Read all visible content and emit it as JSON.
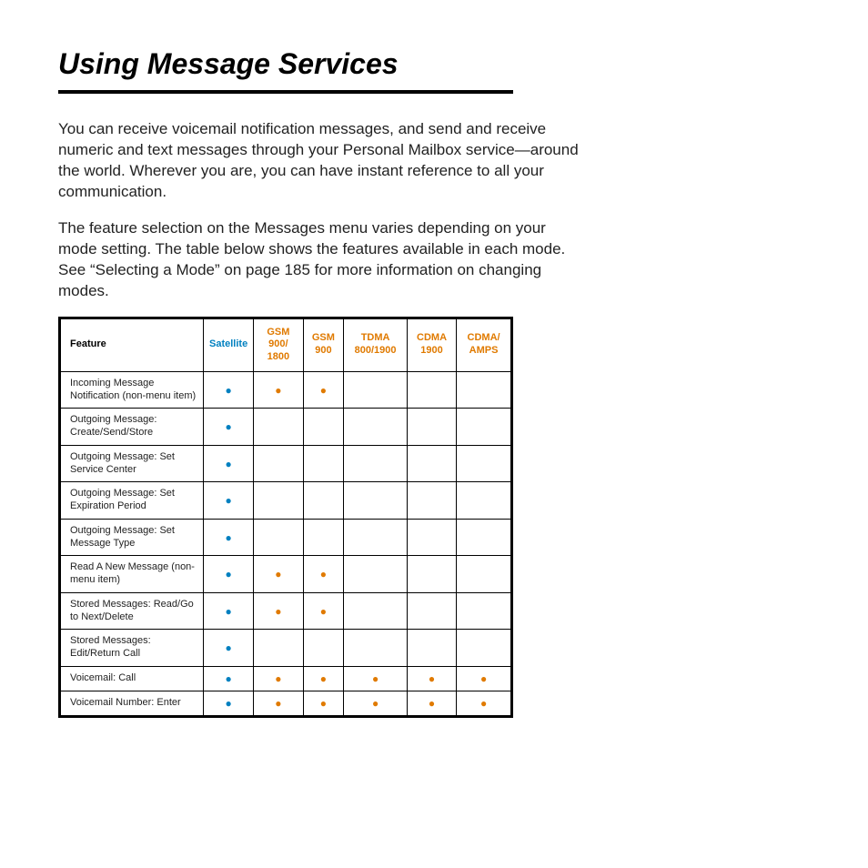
{
  "title": "Using Message Services",
  "para1": "You can receive voicemail notification messages, and send and receive numeric and text messages through your Personal Mailbox service—around the world. Wherever you are, you can have instant reference to all your communication.",
  "para2": "The feature selection on the Messages menu varies depending on your mode setting. The table below shows the features available in each mode. See “Selecting a Mode” on page 185 for more information on changing modes.",
  "headers": {
    "feature": "Feature",
    "satellite": "Satellite",
    "gsm900_1800": "GSM 900/ 1800",
    "gsm900": "GSM 900",
    "tdma": "TDMA 800/1900",
    "cdma": "CDMA 1900",
    "cdma_amps": "CDMA/ AMPS"
  },
  "chart_data": {
    "type": "table",
    "columns": [
      "Satellite",
      "GSM 900/1800",
      "GSM 900",
      "TDMA 800/1900",
      "CDMA 1900",
      "CDMA/AMPS"
    ],
    "rows": [
      {
        "name": "Incoming Message Notification (non-menu item)",
        "values": [
          true,
          true,
          true,
          false,
          false,
          false
        ]
      },
      {
        "name": "Outgoing Message: Create/Send/Store",
        "values": [
          true,
          false,
          false,
          false,
          false,
          false
        ]
      },
      {
        "name": "Outgoing Message: Set Service Center",
        "values": [
          true,
          false,
          false,
          false,
          false,
          false
        ]
      },
      {
        "name": "Outgoing Message: Set Expiration Period",
        "values": [
          true,
          false,
          false,
          false,
          false,
          false
        ]
      },
      {
        "name": "Outgoing Message: Set Message Type",
        "values": [
          true,
          false,
          false,
          false,
          false,
          false
        ]
      },
      {
        "name": "Read A New Message (non-menu item)",
        "values": [
          true,
          true,
          true,
          false,
          false,
          false
        ]
      },
      {
        "name": "Stored Messages: Read/Go to Next/Delete",
        "values": [
          true,
          true,
          true,
          false,
          false,
          false
        ]
      },
      {
        "name": "Stored Messages: Edit/Return Call",
        "values": [
          true,
          false,
          false,
          false,
          false,
          false
        ]
      },
      {
        "name": "Voicemail: Call",
        "values": [
          true,
          true,
          true,
          true,
          true,
          true
        ]
      },
      {
        "name": "Voicemail Number: Enter",
        "values": [
          true,
          true,
          true,
          true,
          true,
          true
        ]
      }
    ]
  }
}
